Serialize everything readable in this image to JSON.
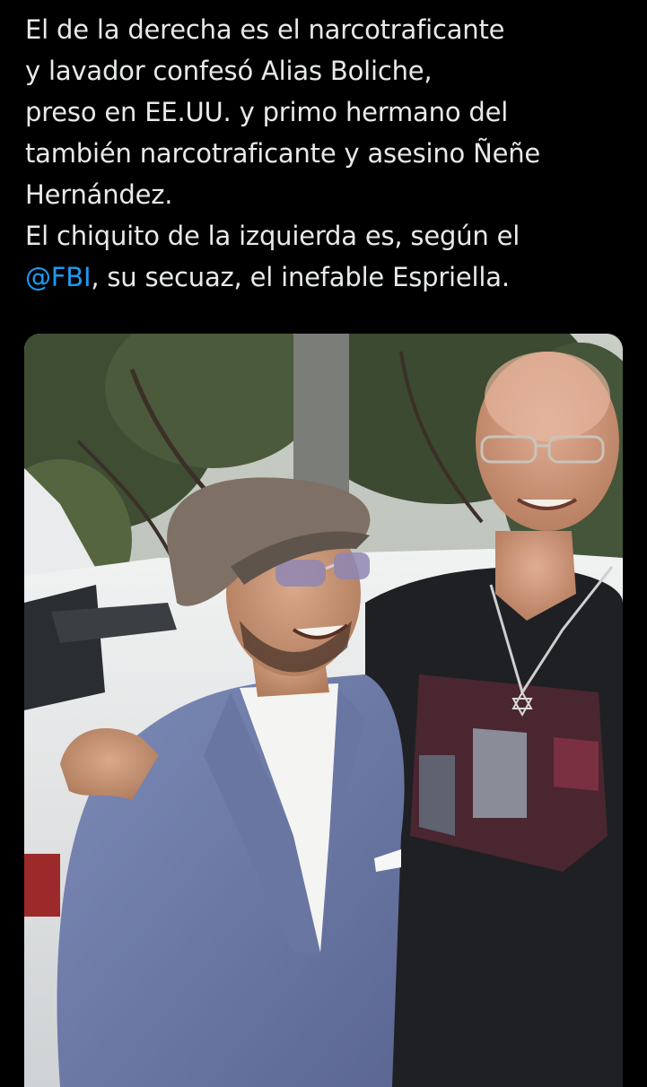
{
  "tweet": {
    "text_lines": [
      "El de la derecha es el narcotraficante",
      "y lavador confesó Alias Boliche,",
      "preso en EE.UU. y primo hermano del",
      "también narcotraficante y asesino Ñeñe",
      "Hernández.",
      "El chiquito de la izquierda es, según el"
    ],
    "last_line": {
      "mention": "@FBI",
      "rest": ",  su secuaz, el inefable Espriella."
    },
    "mention_color": "#1d9bf0",
    "text_color": "#e7e9ea",
    "background": "#000000"
  },
  "media": {
    "type": "photo"
  }
}
